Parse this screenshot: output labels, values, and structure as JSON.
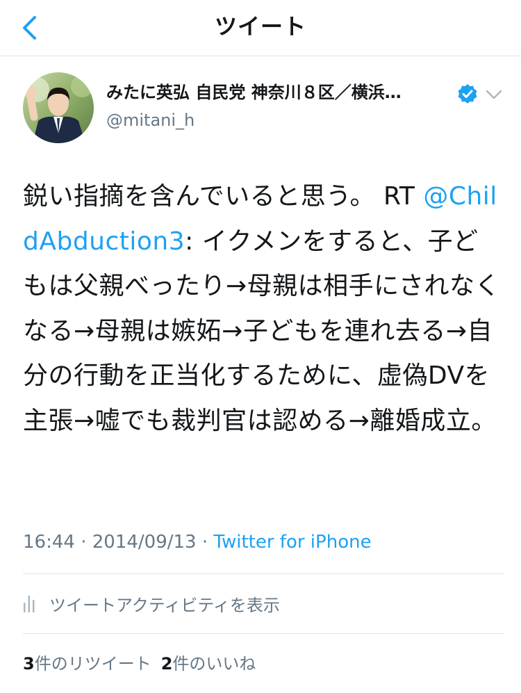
{
  "header": {
    "title": "ツイート",
    "back_icon": "chevron-left-icon"
  },
  "author": {
    "display_name": "みたに英弘 自民党 神奈川８区／横浜…",
    "handle": "@mitani_h",
    "verified": true
  },
  "tweet": {
    "text_before": "鋭い指摘を含んでいると思う。 RT ",
    "mention": "@ChildAbduction3",
    "text_after": ": イクメンをすると、子どもは父親べったり→母親は相手にされなくなる→母親は嫉妬→子どもを連れ去る→自分の行動を正当化するために、虚偽DVを主張→嘘でも裁判官は認める→離婚成立。"
  },
  "meta": {
    "time": "16:44",
    "date": "2014/09/13",
    "separator": " · ",
    "source": "Twitter for iPhone"
  },
  "activity": {
    "label": "ツイートアクティビティを表示",
    "icon": "bar-chart-icon"
  },
  "stats": {
    "retweets_count": "3",
    "retweets_label": "件のリツイート",
    "likes_count": "2",
    "likes_label": "件のいいね"
  },
  "colors": {
    "link": "#1da1f2",
    "secondary": "#657786",
    "divider": "#dfe3e6",
    "text": "#14171a"
  }
}
